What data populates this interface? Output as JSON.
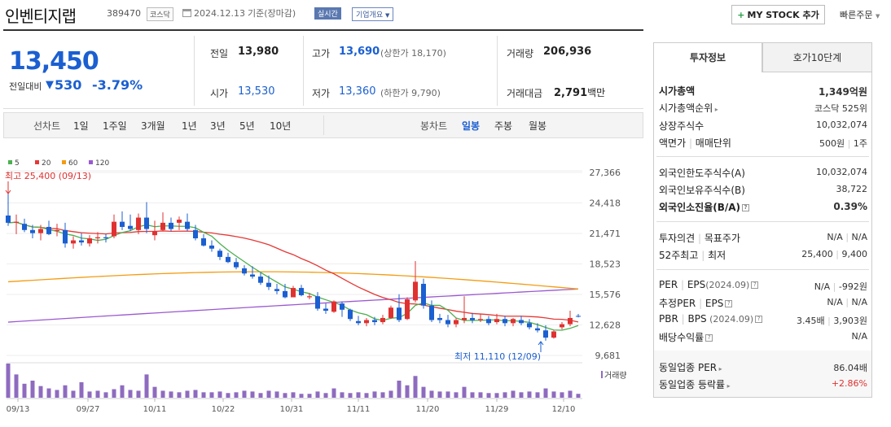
{
  "header": {
    "name": "인벤티지랩",
    "code": "389470",
    "market": "코스닥",
    "date": "2024.12.13",
    "date_note": "기준(장마감)",
    "realtime": "실시간",
    "company_info": "기업개요",
    "mystock": "MY STOCK 추가",
    "quick_order": "빠른주문"
  },
  "quote": {
    "price": "13,450",
    "change_label": "전일대비",
    "change": "530",
    "change_pct": "-3.79%",
    "prev_label": "전일",
    "prev": "13,980",
    "open_label": "시가",
    "open": "13,530",
    "high_label": "고가",
    "high": "13,690",
    "upper_limit": "(상한가 18,170)",
    "low_label": "저가",
    "low": "13,360",
    "lower_limit": "(하한가 9,790)",
    "volume_label": "거래량",
    "volume": "206,936",
    "amount_label": "거래대금",
    "amount": "2,791",
    "amount_unit": "백만"
  },
  "period": {
    "line_label": "선차트",
    "items": [
      "1일",
      "1주일",
      "3개월",
      "1년",
      "3년",
      "5년",
      "10년"
    ],
    "candle_label": "봉차트",
    "candle_items": [
      "일봉",
      "주봉",
      "월봉"
    ]
  },
  "chart_data": {
    "type": "candlestick",
    "ma_legend": [
      {
        "name": "5",
        "color": "#4caf50"
      },
      {
        "name": "20",
        "color": "#e53935"
      },
      {
        "name": "60",
        "color": "#f39c12"
      },
      {
        "name": "120",
        "color": "#9b59d0"
      }
    ],
    "y_ticks": [
      "27,366",
      "24,418",
      "21,471",
      "18,523",
      "15,576",
      "12,628",
      "9,681"
    ],
    "y_min": 9681,
    "y_max": 27366,
    "x_ticks": [
      "09/13",
      "09/27",
      "10/11",
      "10/22",
      "10/31",
      "11/11",
      "11/20",
      "11/29",
      "12/10"
    ],
    "high_label": "최고 25,400 (09/13)",
    "low_label": "최저 11,110 (12/09)",
    "volume_label": "거래량",
    "candles": [
      [
        23200,
        25400,
        22200,
        22500
      ],
      [
        22500,
        23300,
        21400,
        22600
      ],
      [
        22400,
        22900,
        21600,
        21800
      ],
      [
        21800,
        22300,
        21000,
        21500
      ],
      [
        21500,
        22300,
        20800,
        21900
      ],
      [
        22100,
        22700,
        21300,
        21400
      ],
      [
        21700,
        22400,
        21200,
        21800
      ],
      [
        21800,
        22500,
        20100,
        20500
      ],
      [
        20500,
        21200,
        20000,
        20800
      ],
      [
        20800,
        21500,
        20300,
        20600
      ],
      [
        20500,
        21300,
        20200,
        21000
      ],
      [
        21000,
        21600,
        20500,
        21100
      ],
      [
        21100,
        21400,
        20600,
        21000
      ],
      [
        21200,
        23300,
        21000,
        22600
      ],
      [
        22600,
        23600,
        21800,
        22100
      ],
      [
        22200,
        23300,
        21700,
        21900
      ],
      [
        21800,
        23400,
        21400,
        23000
      ],
      [
        23000,
        24500,
        21500,
        21900
      ],
      [
        21300,
        22700,
        20800,
        21700
      ],
      [
        21800,
        23500,
        21700,
        22500
      ],
      [
        22500,
        23000,
        21700,
        21900
      ],
      [
        22500,
        23100,
        21800,
        22800
      ],
      [
        22600,
        23400,
        21700,
        21900
      ],
      [
        21800,
        22300,
        20800,
        21000
      ],
      [
        21000,
        21400,
        20200,
        20300
      ],
      [
        20300,
        20800,
        19700,
        20000
      ],
      [
        19800,
        20000,
        18900,
        19200
      ],
      [
        19200,
        19600,
        18600,
        18700
      ],
      [
        18700,
        19100,
        18000,
        18200
      ],
      [
        18100,
        18400,
        17400,
        17600
      ],
      [
        17500,
        18300,
        17100,
        17300
      ],
      [
        17300,
        17700,
        16500,
        16700
      ],
      [
        16700,
        17400,
        16000,
        16300
      ],
      [
        16100,
        16600,
        15600,
        15900
      ],
      [
        15900,
        16600,
        15200,
        15300
      ],
      [
        15300,
        16400,
        15400,
        16200
      ],
      [
        16200,
        16500,
        15400,
        15500
      ],
      [
        15300,
        15700,
        15100,
        15400
      ],
      [
        15400,
        15800,
        14000,
        14200
      ],
      [
        14200,
        14700,
        13700,
        14000
      ],
      [
        13900,
        15000,
        13800,
        14900
      ],
      [
        14700,
        14900,
        13400,
        14100
      ],
      [
        14100,
        14200,
        13000,
        13200
      ],
      [
        13000,
        13500,
        12600,
        12800
      ],
      [
        12800,
        13300,
        12500,
        13100
      ],
      [
        13100,
        13400,
        12600,
        12900
      ],
      [
        12900,
        13600,
        12700,
        13300
      ],
      [
        13300,
        14500,
        13200,
        14300
      ],
      [
        14300,
        15600,
        12900,
        13100
      ],
      [
        13200,
        15300,
        13100,
        15100
      ],
      [
        15000,
        18800,
        14800,
        16800
      ],
      [
        16600,
        17100,
        14200,
        14500
      ],
      [
        14500,
        15000,
        12900,
        13100
      ],
      [
        13300,
        13700,
        12800,
        13100
      ],
      [
        13100,
        13600,
        12400,
        12700
      ],
      [
        12700,
        13300,
        12400,
        13100
      ],
      [
        13100,
        15400,
        12800,
        13300
      ],
      [
        13300,
        13800,
        12800,
        13100
      ],
      [
        13100,
        13700,
        12900,
        13200
      ],
      [
        13200,
        13500,
        12600,
        12800
      ],
      [
        12900,
        13700,
        12700,
        13200
      ],
      [
        13200,
        13500,
        12500,
        12800
      ],
      [
        12800,
        13300,
        12500,
        13200
      ],
      [
        13100,
        13500,
        12600,
        12800
      ],
      [
        12800,
        13200,
        12200,
        12400
      ],
      [
        12300,
        12800,
        11900,
        12100
      ],
      [
        12100,
        12600,
        11110,
        11400
      ],
      [
        11400,
        12100,
        11300,
        12000
      ],
      [
        12400,
        12900,
        12200,
        12700
      ],
      [
        12700,
        14000,
        12500,
        13300
      ],
      [
        13500,
        13690,
        13360,
        13450
      ]
    ],
    "volume": [
      44,
      30,
      18,
      22,
      15,
      12,
      10,
      16,
      9,
      20,
      8,
      9,
      7,
      11,
      16,
      10,
      9,
      30,
      14,
      9,
      8,
      7,
      9,
      10,
      7,
      7,
      8,
      6,
      7,
      9,
      8,
      6,
      9,
      8,
      6,
      7,
      5,
      5,
      8,
      6,
      12,
      7,
      6,
      7,
      6,
      8,
      7,
      9,
      22,
      16,
      28,
      14,
      9,
      8,
      8,
      7,
      14,
      7,
      7,
      6,
      6,
      7,
      9,
      7,
      8,
      7,
      12,
      8,
      7,
      9,
      5
    ]
  },
  "panel": {
    "tab_info": "투자정보",
    "tab_hoga": "호가10단계",
    "market_cap_label": "시가총액",
    "market_cap": "1,349억원",
    "cap_rank_label": "시가총액순위",
    "cap_rank": "코스닥 525위",
    "shares_label": "상장주식수",
    "shares": "10,032,074",
    "par_label": "액면가",
    "unit_label": "매매단위",
    "par": "500원",
    "unit": "1주",
    "foreign_limit_label": "외국인한도주식수(A)",
    "foreign_limit": "10,032,074",
    "foreign_hold_label": "외국인보유주식수(B)",
    "foreign_hold": "38,722",
    "foreign_ratio_label": "외국인소진율(B/A)",
    "foreign_ratio": "0.39%",
    "opinion_label": "투자의견",
    "target_label": "목표주가",
    "opinion": "N/A",
    "target": "N/A",
    "w52_high_label": "52주최고",
    "w52_low_label": "최저",
    "w52_high": "25,400",
    "w52_low": "9,400",
    "per_label": "PER",
    "eps_label": "EPS",
    "eps_period": "(2024.09)",
    "per": "N/A",
    "eps": "-992원",
    "est_per_label": "추정PER",
    "est_eps_label": "EPS",
    "est_per": "N/A",
    "est_eps": "N/A",
    "pbr_label": "PBR",
    "bps_label": "BPS",
    "bps_period": "(2024.09)",
    "pbr": "3.45배",
    "bps": "3,903원",
    "div_label": "배당수익률",
    "div": "N/A",
    "sector_per_label": "동일업종 PER",
    "sector_per": "86.04배",
    "sector_chg_label": "동일업종 등락률",
    "sector_chg": "+2.86%"
  }
}
